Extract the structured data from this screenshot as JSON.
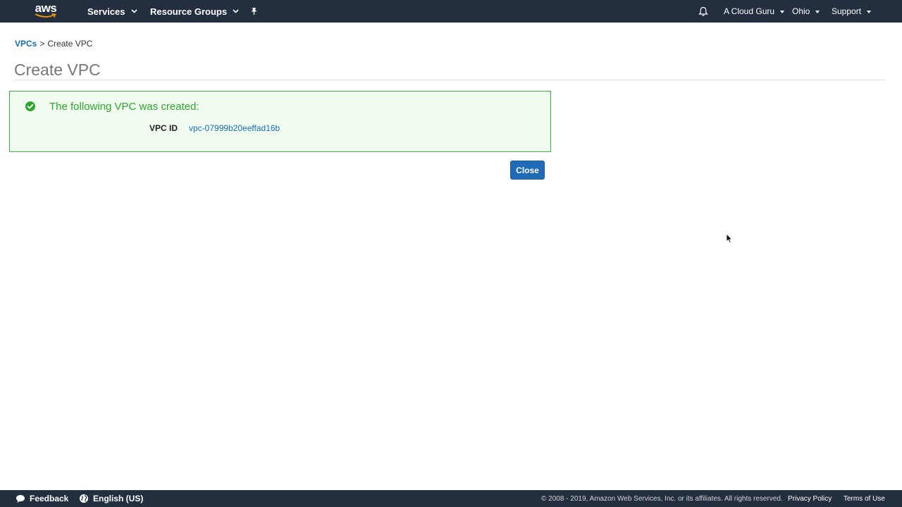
{
  "topnav": {
    "logo": "aws",
    "services": "Services",
    "resource_groups": "Resource Groups",
    "account": "A Cloud Guru",
    "region": "Ohio",
    "support": "Support",
    "icons": [
      "pin-icon",
      "bell-icon"
    ]
  },
  "breadcrumb": {
    "parent": "VPCs",
    "separator": ">",
    "current": "Create VPC"
  },
  "page": {
    "title": "Create VPC"
  },
  "success": {
    "message": "The following VPC was created:",
    "vpc_id_label": "VPC ID",
    "vpc_id_value": "vpc-07999b20eeffad16b",
    "icon": "check-circle-icon",
    "color": "#2ea62e"
  },
  "actions": {
    "close_label": "Close"
  },
  "footer": {
    "feedback": "Feedback",
    "language": "English (US)",
    "copyright": "© 2008 - 2019, Amazon Web Services, Inc. or its affiliates. All rights reserved.",
    "privacy": "Privacy Policy",
    "terms": "Terms of Use"
  },
  "colors": {
    "nav_bg": "#232f3e",
    "link": "#1a6db3",
    "button": "#1f6bb8"
  }
}
